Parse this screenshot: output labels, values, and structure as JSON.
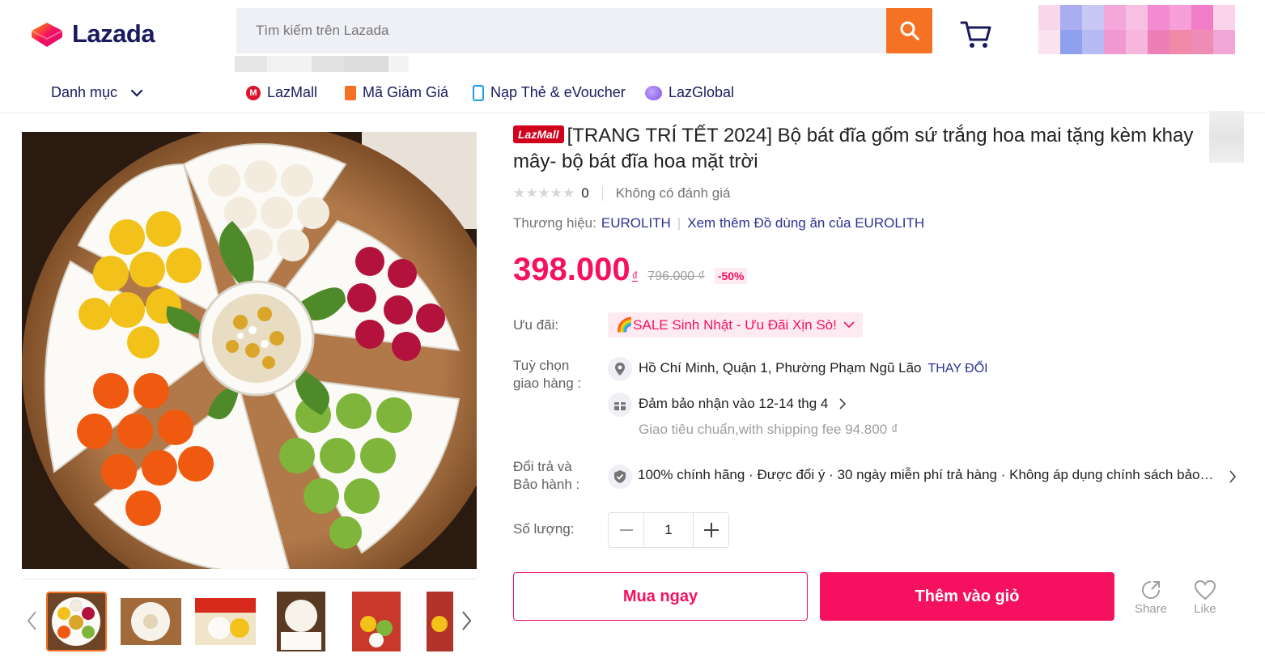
{
  "header": {
    "logo_text": "Lazada",
    "search_placeholder": "Tìm kiếm trên Lazada",
    "nav": {
      "category_label": "Danh mục",
      "links": [
        {
          "label": "LazMall",
          "icon": "lazmall-icon",
          "color": "#e0132d"
        },
        {
          "label": "Mã Giảm Giá",
          "icon": "voucher-icon",
          "color": "#f57224"
        },
        {
          "label": "Nạp Thẻ & eVoucher",
          "icon": "phone-topup-icon",
          "color": "#1a9cf0"
        },
        {
          "label": "LazGlobal",
          "icon": "lazglobal-icon",
          "color": "#7b4fe5"
        }
      ]
    }
  },
  "product": {
    "badge": "LazMall",
    "title": "[TRANG TRÍ TẾT 2024] Bộ bát đĩa gốm sứ trắng hoa mai tặng kèm khay mây- bộ bát đĩa hoa mặt trời",
    "rating_count": "0",
    "rating_text": "Không có đánh giá",
    "brand_label": "Thương hiệu:",
    "brand_name": "EUROLITH",
    "brand_more": "Xem thêm Đồ dùng ăn của EUROLITH",
    "price": "398.000",
    "currency": "₫",
    "original_price": "796.000 ₫",
    "discount": "-50%"
  },
  "details": {
    "promo_label": "Ưu đãi:",
    "promo_text": "🌈SALE Sinh Nhật - Ưu Đãi Xịn Sò!",
    "delivery_label_1": "Tuỳ chọn",
    "delivery_label_2": "giao hàng :",
    "location": "Hồ Chí Minh, Quận 1, Phường Phạm Ngũ Lão",
    "change_label": "THAY ĐỔI",
    "guarantee": "Đảm bảo nhận vào 12-14 thg 4",
    "shipping_fee": "Giao tiêu chuẩn,with shipping fee 94.800 ₫",
    "warranty_label_1": "Đổi trả và",
    "warranty_label_2": "Bảo hành :",
    "warranty_text": "100% chính hãng · Được đổi ý · 30 ngày miễn phí trả hàng · Không áp dụng chính sách bảo hành",
    "qty_label": "Số lượng:",
    "qty_value": "1"
  },
  "actions": {
    "buy_now": "Mua ngay",
    "add_to_cart": "Thêm vào giỏ",
    "share": "Share",
    "like": "Like"
  },
  "colors": {
    "accent": "#f5115f",
    "search_button": "#f57224",
    "link": "#2e3192"
  }
}
